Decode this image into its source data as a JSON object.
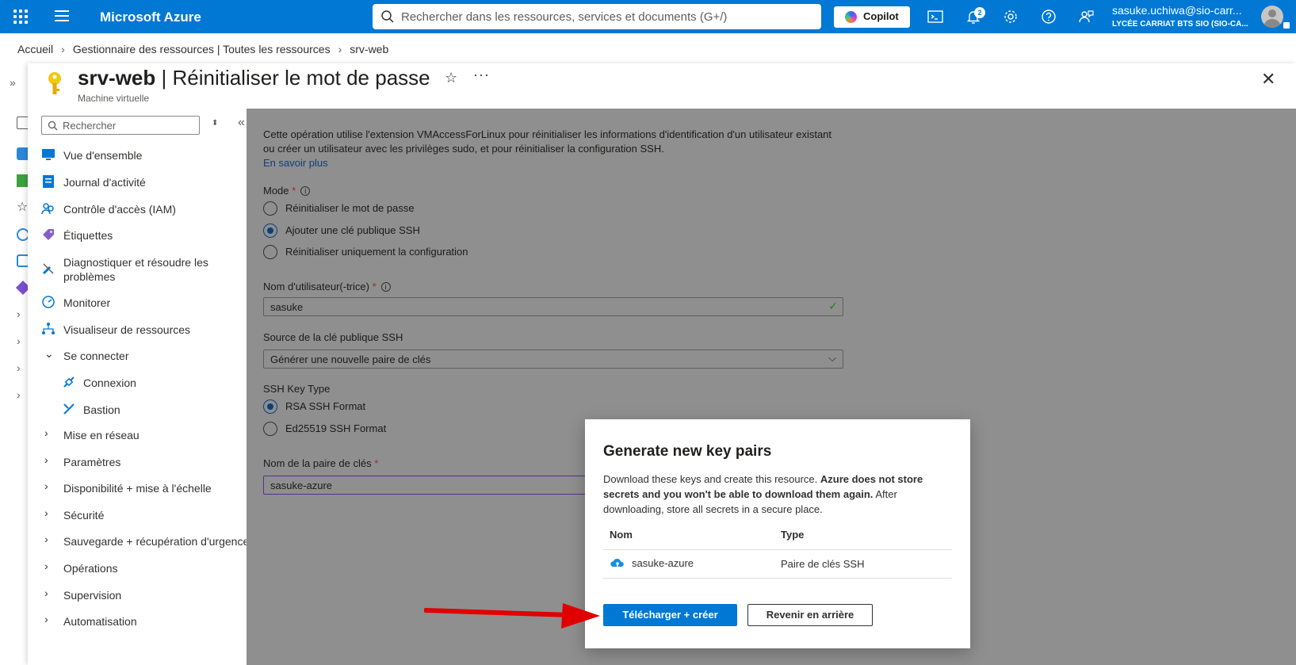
{
  "topbar": {
    "brand": "Microsoft Azure",
    "search_placeholder": "Rechercher dans les ressources, services et documents (G+/)",
    "copilot_label": "Copilot",
    "notification_count": "2",
    "user_name": "sasuke.uchiwa@sio-carr...",
    "tenant": "LYCÉE CARRIAT BTS SIO (SIO-CA..."
  },
  "breadcrumb": [
    "Accueil",
    "Gestionnaire des ressources | Toutes les ressources",
    "srv-web"
  ],
  "blade": {
    "resource_name": "srv-web",
    "title_rest": " | Réinitialiser le mot de passe",
    "subtitle": "Machine virtuelle"
  },
  "menu": {
    "search_placeholder": "Rechercher",
    "items": [
      {
        "label": "Vue d'ensemble"
      },
      {
        "label": "Journal d'activité"
      },
      {
        "label": "Contrôle d'accès (IAM)"
      },
      {
        "label": "Étiquettes"
      },
      {
        "label": "Diagnostiquer et résoudre les problèmes"
      },
      {
        "label": "Monitorer"
      },
      {
        "label": "Visualiseur de ressources"
      },
      {
        "label": "Se connecter"
      },
      {
        "label": "Connexion"
      },
      {
        "label": "Bastion"
      },
      {
        "label": "Mise en réseau"
      },
      {
        "label": "Paramètres"
      },
      {
        "label": "Disponibilité + mise à l'échelle"
      },
      {
        "label": "Sécurité"
      },
      {
        "label": "Sauvegarde + récupération d'urgence"
      },
      {
        "label": "Opérations"
      },
      {
        "label": "Supervision"
      },
      {
        "label": "Automatisation"
      }
    ]
  },
  "form": {
    "intro": "Cette opération utilise l'extension VMAccessForLinux pour réinitialiser les informations d'identification d'un utilisateur existant ou créer un utilisateur avec les privilèges sudo, et pour réinitialiser la configuration SSH.",
    "learn_more": "En savoir plus",
    "mode_label": "Mode",
    "mode_options": [
      "Réinitialiser le mot de passe",
      "Ajouter une clé publique SSH",
      "Réinitialiser uniquement la configuration"
    ],
    "mode_selected": 1,
    "username_label": "Nom d'utilisateur(-trice)",
    "username_value": "sasuke",
    "source_label": "Source de la clé publique SSH",
    "source_value": "Générer une nouvelle paire de clés",
    "keytype_label": "SSH Key Type",
    "keytype_options": [
      "RSA SSH Format",
      "Ed25519 SSH Format"
    ],
    "keytype_selected": 0,
    "keyname_label": "Nom de la paire de clés",
    "keyname_value": "sasuke-azure"
  },
  "dialog": {
    "title": "Generate new key pairs",
    "msg_start": "Download these keys and create this resource. ",
    "msg_bold": "Azure does not store secrets and you won't be able to download them again.",
    "msg_end": " After downloading, store all secrets in a secure place.",
    "col_name": "Nom",
    "col_type": "Type",
    "row_name": "sasuke-azure",
    "row_type": "Paire de clés SSH",
    "primary_button": "Télécharger + créer",
    "secondary_button": "Revenir en arrière"
  },
  "colors": {
    "accent": "#0078d4",
    "annotation_arrow": "#e00000",
    "overlay": "#8f8f8f"
  }
}
